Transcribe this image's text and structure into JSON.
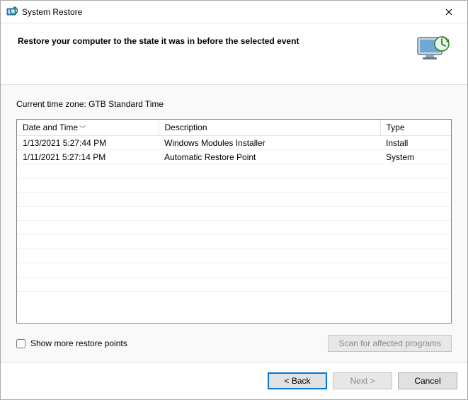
{
  "window": {
    "title": "System Restore"
  },
  "header": {
    "heading": "Restore your computer to the state it was in before the selected event"
  },
  "timezone": {
    "label": "Current time zone:",
    "value": "GTB Standard Time"
  },
  "table": {
    "columns": {
      "datetime": "Date and Time",
      "description": "Description",
      "type": "Type"
    },
    "rows": [
      {
        "datetime": "1/13/2021 5:27:44 PM",
        "description": "Windows Modules Installer",
        "type": "Install"
      },
      {
        "datetime": "1/11/2021 5:27:14 PM",
        "description": "Automatic Restore Point",
        "type": "System"
      }
    ]
  },
  "options": {
    "show_more_label": "Show more restore points",
    "show_more_checked": false
  },
  "buttons": {
    "scan": "Scan for affected programs",
    "back": "< Back",
    "next": "Next >",
    "cancel": "Cancel"
  }
}
